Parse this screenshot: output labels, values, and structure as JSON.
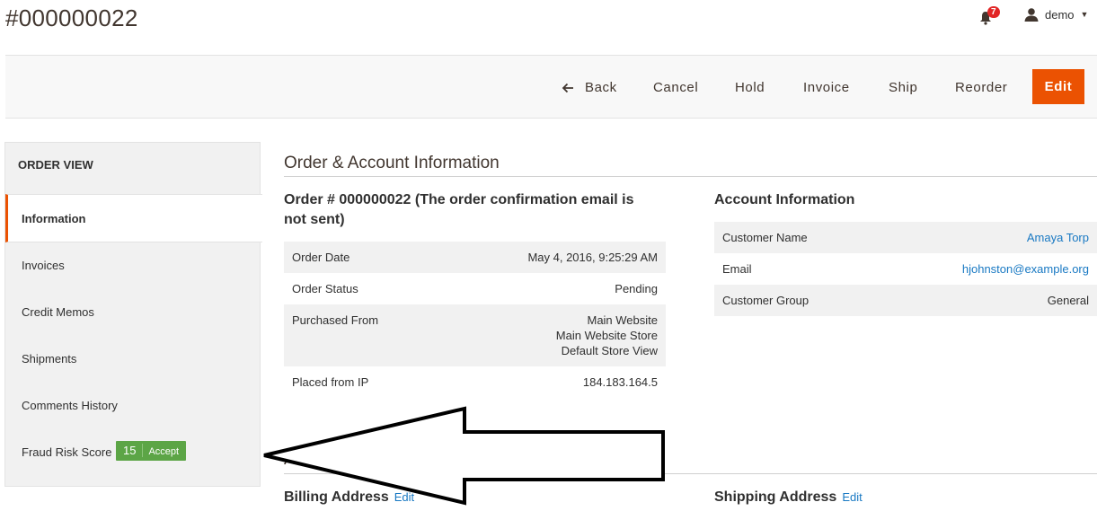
{
  "header": {
    "title": "#000000022",
    "notifications_count": "7",
    "user_name": "demo"
  },
  "actions": {
    "back": "Back",
    "cancel": "Cancel",
    "hold": "Hold",
    "invoice": "Invoice",
    "ship": "Ship",
    "reorder": "Reorder",
    "edit": "Edit"
  },
  "sidebar": {
    "title": "ORDER VIEW",
    "items": [
      {
        "label": "Information"
      },
      {
        "label": "Invoices"
      },
      {
        "label": "Credit Memos"
      },
      {
        "label": "Shipments"
      },
      {
        "label": "Comments History"
      },
      {
        "label": "Fraud Risk Score"
      }
    ],
    "fraud_score": "15",
    "fraud_recommendation": "Accept"
  },
  "order_account": {
    "section_title": "Order & Account Information",
    "order_title_line1": "Order # 000000022 (The order confirmation email is",
    "order_title_line2": "not sent)",
    "order_rows": [
      {
        "label": "Order Date",
        "value": "May 4, 2016, 9:25:29 AM"
      },
      {
        "label": "Order Status",
        "value": "Pending"
      },
      {
        "label": "Purchased From",
        "value_lines": [
          "Main Website",
          "Main Website Store",
          "Default Store View"
        ]
      },
      {
        "label": "Placed from IP",
        "value": "184.183.164.5"
      }
    ],
    "account_title": "Account Information",
    "account_rows": [
      {
        "label": "Customer Name",
        "value": "Amaya Torp"
      },
      {
        "label": "Email",
        "value": "hjohnston@example.org"
      },
      {
        "label": "Customer Group",
        "value": "General"
      }
    ]
  },
  "address": {
    "section_title": "Address Information",
    "billing_title": "Billing Address",
    "billing_edit": "Edit",
    "shipping_title": "Shipping Address",
    "shipping_edit": "Edit"
  },
  "colors": {
    "accent": "#eb5202",
    "link": "#1979c3",
    "badge_green": "#5ca546"
  }
}
